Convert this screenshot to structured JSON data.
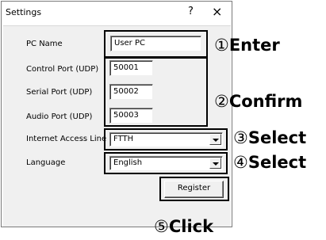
{
  "window": {
    "title": "Settings",
    "help_label": "?",
    "close_label": "×"
  },
  "form": {
    "pc_name": {
      "label": "PC Name",
      "value": "User PC"
    },
    "control_port": {
      "label": "Control Port (UDP)",
      "value": "50001"
    },
    "serial_port": {
      "label": "Serial Port (UDP)",
      "value": "50002"
    },
    "audio_port": {
      "label": "Audio Port (UDP)",
      "value": "50003"
    },
    "internet_access_line": {
      "label": "Internet Access Line",
      "value": "FTTH"
    },
    "language": {
      "label": "Language",
      "value": "English"
    },
    "register_label": "Register"
  },
  "callouts": [
    {
      "num": "①",
      "word": "Enter"
    },
    {
      "num": "②",
      "word": "Confirm"
    },
    {
      "num": "③",
      "word": "Select"
    },
    {
      "num": "④",
      "word": "Select"
    },
    {
      "num": "⑤",
      "word": "Click"
    }
  ]
}
